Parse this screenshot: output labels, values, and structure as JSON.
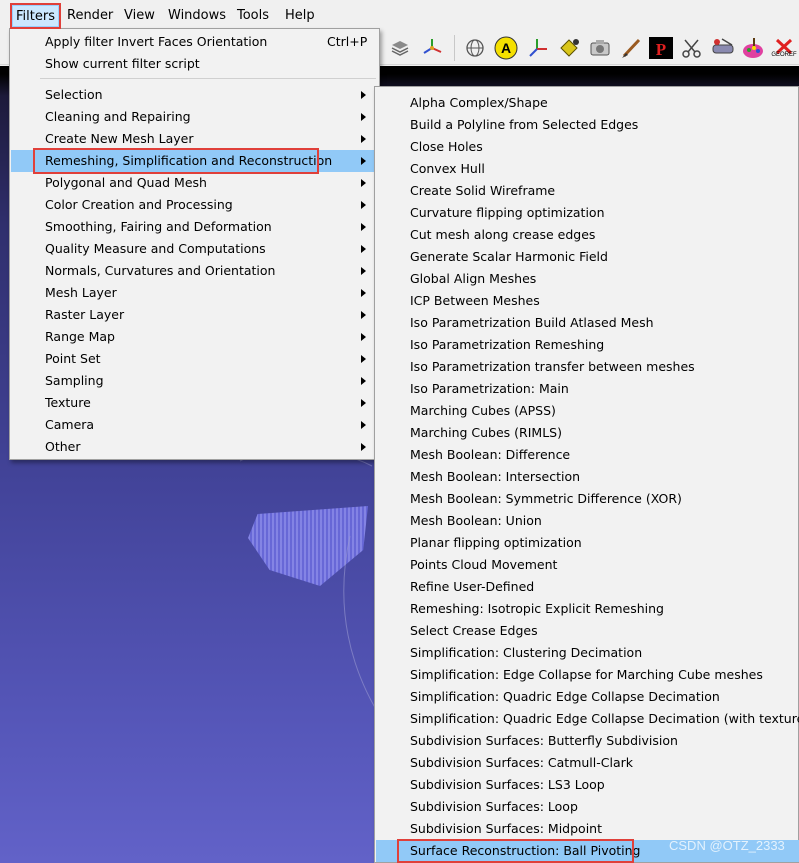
{
  "menubar": {
    "items": [
      {
        "id": "filters",
        "label": "Filters"
      },
      {
        "id": "render",
        "label": "Render"
      },
      {
        "id": "view",
        "label": "View"
      },
      {
        "id": "windows",
        "label": "Windows"
      },
      {
        "id": "tools",
        "label": "Tools"
      },
      {
        "id": "help",
        "label": "Help"
      }
    ]
  },
  "toolbar": {
    "icons": [
      "layers-icon",
      "axis-gizmo-icon",
      "globe-icon",
      "annotation-a-icon",
      "axes-icon",
      "paint-bucket-icon",
      "camera-icon",
      "brush-icon",
      "pdf-icon",
      "scissors-icon",
      "paint-icon",
      "color-palette-icon",
      "close-georef-icon"
    ],
    "label_georef": "GEOREF"
  },
  "filters_menu": {
    "apply_label": "Apply filter Invert Faces Orientation",
    "apply_shortcut": "Ctrl+P",
    "show_script_label": "Show current filter script",
    "categories": [
      "Selection",
      "Cleaning and Repairing",
      "Create New Mesh Layer",
      "Remeshing, Simplification and Reconstruction",
      "Polygonal and Quad Mesh",
      "Color Creation and Processing",
      "Smoothing, Fairing and Deformation",
      "Quality Measure and Computations",
      "Normals, Curvatures and Orientation",
      "Mesh Layer",
      "Raster Layer",
      "Range Map",
      "Point Set",
      "Sampling",
      "Texture",
      "Camera",
      "Other"
    ]
  },
  "submenu": {
    "items": [
      "Alpha Complex/Shape",
      "Build a Polyline from Selected Edges",
      "Close Holes",
      "Convex Hull",
      "Create Solid Wireframe",
      "Curvature flipping optimization",
      "Cut mesh along crease edges",
      "Generate Scalar Harmonic Field",
      "Global Align Meshes",
      "ICP Between Meshes",
      "Iso Parametrization Build Atlased Mesh",
      "Iso Parametrization Remeshing",
      "Iso Parametrization transfer between meshes",
      "Iso Parametrization: Main",
      "Marching Cubes (APSS)",
      "Marching Cubes (RIMLS)",
      "Mesh Boolean: Difference",
      "Mesh Boolean: Intersection",
      "Mesh Boolean: Symmetric Difference (XOR)",
      "Mesh Boolean: Union",
      "Planar flipping optimization",
      "Points Cloud Movement",
      "Refine User-Defined",
      "Remeshing: Isotropic Explicit Remeshing",
      "Select Crease Edges",
      "Simplification: Clustering Decimation",
      "Simplification: Edge Collapse for Marching Cube meshes",
      "Simplification: Quadric Edge Collapse Decimation",
      "Simplification: Quadric Edge Collapse Decimation (with texture)",
      "Subdivision Surfaces: Butterfly Subdivision",
      "Subdivision Surfaces: Catmull-Clark",
      "Subdivision Surfaces: LS3 Loop",
      "Subdivision Surfaces: Loop",
      "Subdivision Surfaces: Midpoint",
      "Surface Reconstruction: Ball Pivoting"
    ]
  },
  "watermark": "CSDN @OTZ_2333",
  "colors": {
    "highlight": "#91c9f7",
    "annotation_box": "#e0403a",
    "menu_bg": "#f2f2f2"
  }
}
